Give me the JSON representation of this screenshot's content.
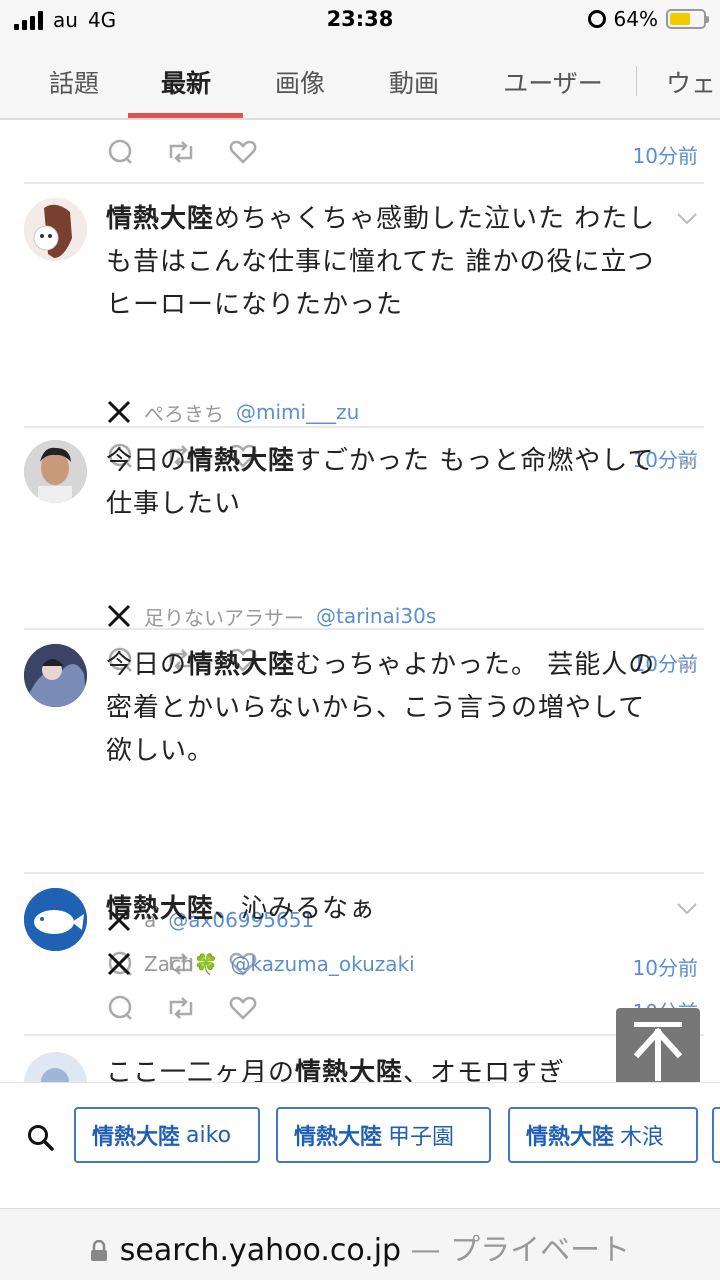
{
  "status_bar": {
    "carrier": "au",
    "network": "4G",
    "time": "23:38",
    "battery": "64%",
    "battery_level": 0.64
  },
  "tabs": [
    {
      "label": "話題",
      "active": false
    },
    {
      "label": "最新",
      "active": true
    },
    {
      "label": "画像",
      "active": false
    },
    {
      "label": "動画",
      "active": false
    },
    {
      "label": "ユーザー",
      "active": false
    },
    {
      "label": "ウェ",
      "active": false
    }
  ],
  "top_actions_time": "10分前",
  "posts": [
    {
      "keyword": "情熱大陸",
      "text": "めちゃくちゃ感動した泣いた わたしも昔はこんな仕事に憧れてた 誰かの役に立つヒーローになりたかった",
      "author_name": "ぺろきち",
      "author_handle": "@mimi___zu",
      "time": "10分前"
    },
    {
      "prefix": "今日の",
      "keyword": "情熱大陸",
      "text": "すごかった もっと命燃やして仕事したい",
      "author_name": "足りないアラサー",
      "author_handle": "@tarinai30s",
      "time": "10分前"
    },
    {
      "prefix": "今日の",
      "keyword": "情熱大陸",
      "text": "むっちゃよかった。 芸能人の密着とかいらないから、こう言うの増やして欲しい。",
      "author_name": "a",
      "author_handle": "@ax06995651",
      "time": "10分前"
    },
    {
      "keyword": "情熱大陸",
      "text": "、沁みるなぁ",
      "author_name": "Zach🍀",
      "author_handle": "@kazuma_okuzaki",
      "time": "10分前"
    },
    {
      "prefix": "ここ一二ヶ月の",
      "keyword": "情熱大陸",
      "text": "、オモロすぎ"
    }
  ],
  "chips": [
    {
      "keyword": "情熱大陸",
      "term": "aiko"
    },
    {
      "keyword": "情熱大陸",
      "term": "甲子園"
    },
    {
      "keyword": "情熱大陸",
      "term": "木浪"
    }
  ],
  "url_bar": {
    "domain": "search.yahoo.co.jp",
    "suffix": "— プライベート"
  },
  "icons": {
    "reply": "reply-icon",
    "retweet": "retweet-icon",
    "like": "heart-icon",
    "source": "x-logo-icon",
    "scroll_top": "arrow-up-icon",
    "search": "search-icon",
    "lock": "lock-icon"
  },
  "colors": {
    "accent_tab": "#e0524c",
    "link": "#5b8fd0",
    "chip_border": "#3f78c4",
    "battery": "#f3c900"
  }
}
